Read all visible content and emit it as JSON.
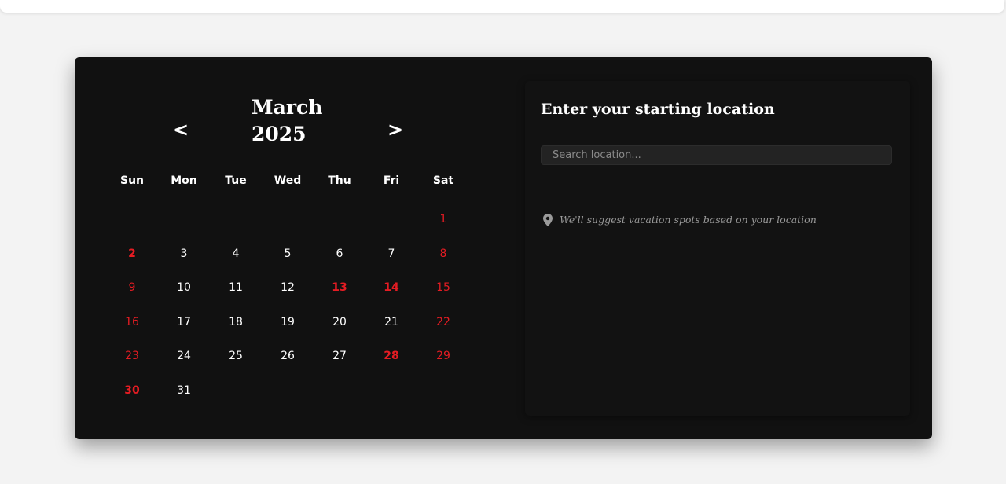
{
  "calendar": {
    "month": "March",
    "year": "2025",
    "prev_label": "<",
    "next_label": ">",
    "weekdays": [
      "Sun",
      "Mon",
      "Tue",
      "Wed",
      "Thu",
      "Fri",
      "Sat"
    ],
    "leading_blanks": 6,
    "days": [
      {
        "n": "1",
        "style": "weekend"
      },
      {
        "n": "2",
        "style": "holiday"
      },
      {
        "n": "3",
        "style": "normal"
      },
      {
        "n": "4",
        "style": "normal"
      },
      {
        "n": "5",
        "style": "normal"
      },
      {
        "n": "6",
        "style": "normal"
      },
      {
        "n": "7",
        "style": "normal"
      },
      {
        "n": "8",
        "style": "weekend"
      },
      {
        "n": "9",
        "style": "weekend"
      },
      {
        "n": "10",
        "style": "normal"
      },
      {
        "n": "11",
        "style": "normal"
      },
      {
        "n": "12",
        "style": "normal"
      },
      {
        "n": "13",
        "style": "holiday"
      },
      {
        "n": "14",
        "style": "holiday"
      },
      {
        "n": "15",
        "style": "weekend"
      },
      {
        "n": "16",
        "style": "weekend"
      },
      {
        "n": "17",
        "style": "normal"
      },
      {
        "n": "18",
        "style": "normal"
      },
      {
        "n": "19",
        "style": "normal"
      },
      {
        "n": "20",
        "style": "normal"
      },
      {
        "n": "21",
        "style": "normal"
      },
      {
        "n": "22",
        "style": "weekend"
      },
      {
        "n": "23",
        "style": "weekend"
      },
      {
        "n": "24",
        "style": "normal"
      },
      {
        "n": "25",
        "style": "normal"
      },
      {
        "n": "26",
        "style": "normal"
      },
      {
        "n": "27",
        "style": "normal"
      },
      {
        "n": "28",
        "style": "holiday"
      },
      {
        "n": "29",
        "style": "weekend"
      },
      {
        "n": "30",
        "style": "holiday"
      },
      {
        "n": "31",
        "style": "normal"
      }
    ]
  },
  "location": {
    "title": "Enter your starting location",
    "search_placeholder": "Search location...",
    "hint": "We'll suggest vacation spots based on your location"
  },
  "colors": {
    "panel_bg": "#111111",
    "weekend_red": "#e51c23",
    "text": "#ffffff",
    "hint_gray": "#9a9a9a"
  },
  "icons": {
    "hint_icon": "map-pin-icon"
  }
}
